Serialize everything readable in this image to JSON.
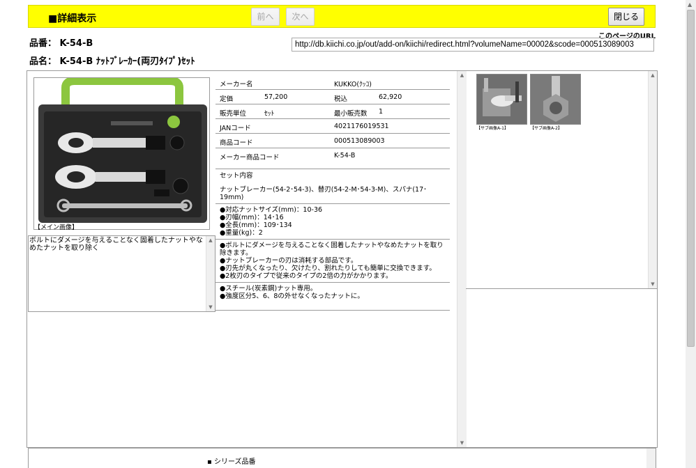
{
  "header": {
    "title": "■詳細表示",
    "prev_label": "前へ",
    "next_label": "次へ",
    "close_label": "閉じる"
  },
  "product": {
    "part_number": "品番： K-54-B",
    "name": "品名： K-54-B ﾅｯﾄﾌﾞﾚｰｶｰ(両刃ﾀｲﾌﾟ)ｾｯﾄ"
  },
  "page_url": {
    "label": "このページのURL",
    "value": "http://db.kiichi.co.jp/out/add-on/kiichi/redirect.html?volumeName=00002&scode=000513089003"
  },
  "main_image": {
    "caption": "【メイン画像】"
  },
  "description": "ボルトにダメージを与えることなく固着したナットやなめたナットを取り除く",
  "spec": {
    "maker_label": "メーカー名",
    "maker": "KUKKO(ｸｯｺ)",
    "price_label": "定価",
    "price": "57,200",
    "tax_label": "税込",
    "tax_price": "62,920",
    "unit_label": "販売単位",
    "unit": "ｾｯﾄ",
    "min_label": "最小販売数",
    "min_qty": "1",
    "jan_label": "JANコード",
    "jan": "4021176019531",
    "code_label": "商品コード",
    "code": "000513089003",
    "maker_code_label": "メーカー商品コード",
    "maker_code": "K-54-B",
    "set_label": "セット内容",
    "set_contents": "ナットブレーカー(54-2･54-3)、替刃(54-2-M･54-3-M)、スパナ(17･19mm)",
    "features1": [
      "●対応ナットサイズ(mm)：10-36",
      "●刃幅(mm)：14･16",
      "●全長(mm)：109･134",
      "●重量(kg)：2"
    ],
    "features2": [
      "●ボルトにダメージを与えることなく固着したナットやなめたナットを取り除きます。",
      "●ナットブレーカーの刃は消耗する部品です。",
      "●刃先が丸くなったり、欠けたり、割れたりしても簡単に交換できます。",
      "●2枚刃のタイプで従来のタイプの2倍の力がかかります。"
    ],
    "features3": [
      "●スチール(炭素鋼)ナット専用。",
      "●強度区分5、6、8の外せなくなったナットに。"
    ]
  },
  "thumbnails": [
    {
      "caption": "【サブ画像A-1】"
    },
    {
      "caption": "【サブ画像A-2】"
    }
  ],
  "series": {
    "label": "シリーズ品番"
  },
  "colors": {
    "header_bg": "#ffff00",
    "border": "#9a9a9a"
  }
}
